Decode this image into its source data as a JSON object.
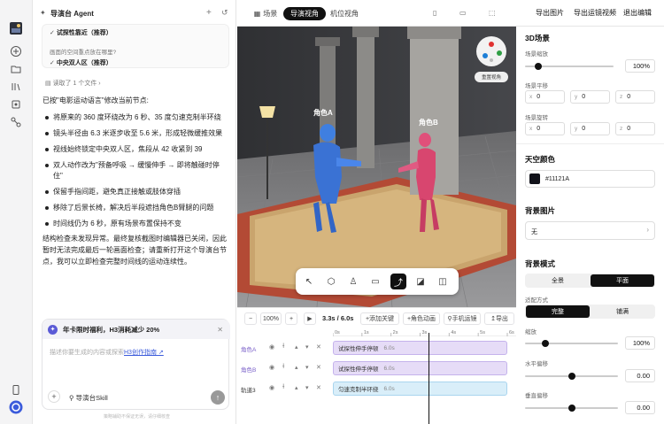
{
  "rail": {
    "icons": [
      "avatar",
      "plus-icon",
      "folder-icon",
      "library-icon",
      "puzzle-icon",
      "share-icon",
      "phone-icon",
      "help-icon"
    ]
  },
  "agent": {
    "title": "导演台 Agent",
    "checked_item": "试探性靠近（推荐）",
    "question": "画面的空间重点放在哪里?",
    "answer": "中央双人区（推荐）",
    "read_files": "读取了 1 个文件",
    "intro": "已按\"电影运动语言\"修改当前节点:",
    "bullets": [
      "将原来的 360 度环绕改为 6 秒、35 度匀速克制半环绕",
      "镜头半径由 6.3 米逐步收至 5.6 米，形成轻微缓推效果",
      "视线始终锁定中央双人区，焦段从 42 收紧到 39",
      "双人动作改为\"预备呼吸 → 缓慢伸手 → 即将触碰时停住\"",
      "保留手指间距，避免真正接触或肢体穿插",
      "移除了后景长椅，解决后半段遮挡角色B臂腿的问题",
      "时间线仍为 6 秒，原有场景布置保持不变"
    ],
    "summary": "结构检查未发现异常。最终复核截图时编辑器已关闭，因此暂时无法完成最后一轮画面检查；请重新打开这个导演台节点，我可以立即检查完整时间线的运动连续性。",
    "promo": "年卡限时福利，H3消耗减少 20%",
    "input_placeholder": "描述你要生成的内容或探索",
    "input_link": "H3创作指南 ↗",
    "skill_label": "导演台Skill",
    "disclaimer": "策略辅助不保证无误，请仔细核查"
  },
  "topbar": {
    "tabs": [
      "场景",
      "导演视角",
      "机位视角"
    ],
    "active_tab": 1,
    "export_image": "导出图片",
    "export_video": "导出运镜视频",
    "exit_edit": "退出编辑"
  },
  "viewport": {
    "char_a": "角色A",
    "char_b": "角色B",
    "reset_view": "重置视角"
  },
  "timeline": {
    "zoom": "100%",
    "time": "3.3s / 6.0s",
    "add_keyframe": "添加关键",
    "char_anim": "角色动画",
    "phone_cam": "手机运镜",
    "export": "导出",
    "ticks": [
      "0s",
      "1s",
      "2s",
      "3s",
      "4s",
      "5s",
      "6s"
    ],
    "playhead": 3.3,
    "duration": 6,
    "tracks": [
      {
        "name": "角色A",
        "clip": "试探性伸手停顿",
        "dur": "6.0s",
        "color": "#e6dcf7",
        "border": "#c5b3ec"
      },
      {
        "name": "角色B",
        "clip": "试探性伸手停顿",
        "dur": "6.0s",
        "color": "#e6dcf7",
        "border": "#c5b3ec"
      },
      {
        "name": "轨道3",
        "clip": "匀速克制半环绕",
        "dur": "6.0s",
        "color": "#d9eef9",
        "border": "#a9d5ee"
      }
    ]
  },
  "props": {
    "scene_title": "3D场景",
    "scale_label": "场景缩放",
    "scale_value": "100%",
    "scale_level": 0.12,
    "pan_label": "场景平移",
    "pan": {
      "x": "0",
      "y": "0",
      "z": "0"
    },
    "rot_label": "场景旋转",
    "rot": {
      "x": "0",
      "y": "0",
      "z": "0"
    },
    "sky_title": "天空颜色",
    "sky_color": "#11121A",
    "bg_title": "背景图片",
    "bg_value": "无",
    "mode_title": "背景模式",
    "mode_opts": [
      "全景",
      "平面"
    ],
    "mode_active": 1,
    "fit_label": "适配方式",
    "fit_opts": [
      "完整",
      "铺满"
    ],
    "fit_active": 0,
    "zoom_label": "缩放",
    "zoom_value": "100%",
    "zoom_level": 0.2,
    "hoff_label": "水平偏移",
    "hoff_value": "0.00",
    "hoff_level": 0.5,
    "voff_label": "垂直偏移",
    "voff_value": "0.00",
    "voff_level": 0.5
  }
}
